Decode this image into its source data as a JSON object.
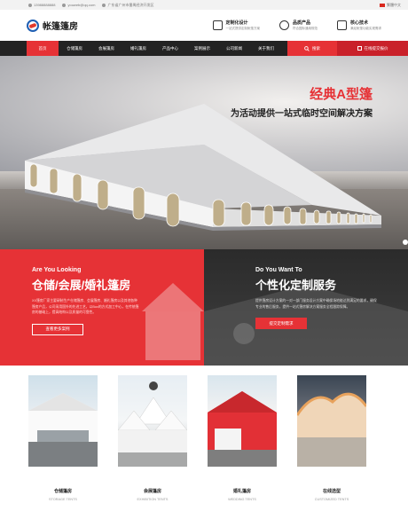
{
  "topbar": {
    "phone": "13988888888",
    "email": "youweb@qq.com",
    "address": "广东省广州市番禺经济开发区",
    "language": "繁體中文"
  },
  "header": {
    "logo_text": "帐篷篷房",
    "features": [
      {
        "title": "定制化设计",
        "subtitle": "一站式提供定制帐篷方案",
        "icon": "wrench-icon"
      },
      {
        "title": "品质产品",
        "subtitle": "符合国际通用规范"
      },
      {
        "title": "核心技术",
        "subtitle": "满足帐篷功能实现需求",
        "icon": "star-icon"
      }
    ]
  },
  "nav": {
    "items": [
      "首页",
      "仓储篷房",
      "会展篷房",
      "婚礼篷房",
      "产品中心",
      "案例展示",
      "公司新闻",
      "关于我们"
    ],
    "active_index": 0,
    "search_label": "搜索",
    "quote_label": "在线提交报价"
  },
  "hero": {
    "title": "经典A型篷",
    "subtitle": "为活动提供一站式临时空间解决方案"
  },
  "promo_left": {
    "en": "Are You Looking",
    "cn": "仓储/会展/婚礼篷房",
    "desc": "XX篷房厂家主要研制生产仓储篷房、会展篷房、婚礼篷房以及其他各种篷房产品，公司采用国外的先进工艺，以Box的方式加工中心，在传统篷房的基础上，提高结构以及质量的可靠性。",
    "button": "查看更多案例"
  },
  "promo_right": {
    "en": "Do You Want To",
    "cn": "个性化定制服务",
    "desc": "提供篷房设计方案的一对一部门服务设计方案中确保场地能达到满足的要求，确保专业的售后服务，提供一站式篷房解决方案服务全程跟踪保障。",
    "button": "提交定制需求"
  },
  "cards": [
    {
      "name": "仓储篷房",
      "en": "STORAGE TENTS"
    },
    {
      "name": "会展篷房",
      "en": "EXHIBITION TENTS"
    },
    {
      "name": "婚礼篷房",
      "en": "WEDDING TENTS"
    },
    {
      "name": "在线选型",
      "en": "CUSTOMIZED TENTS"
    }
  ],
  "colors": {
    "accent": "#e63236",
    "dark": "#232323"
  }
}
